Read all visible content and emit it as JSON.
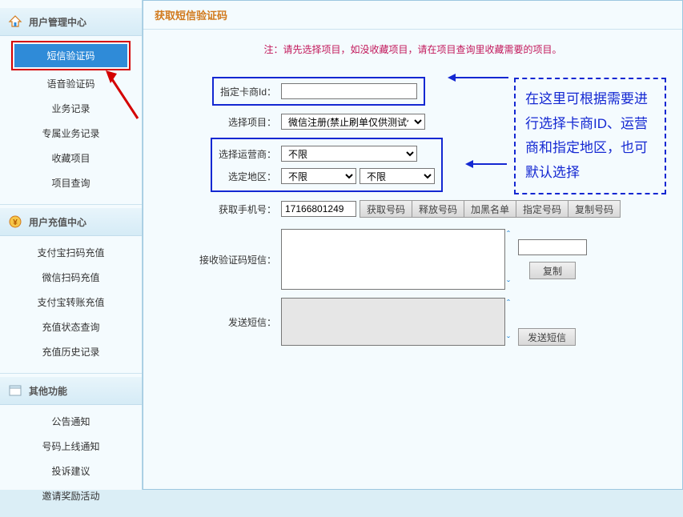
{
  "sidebar": {
    "section1": {
      "title": "用户管理中心",
      "items": [
        "短信验证码",
        "语音验证码",
        "业务记录",
        "专属业务记录",
        "收藏项目",
        "项目查询"
      ],
      "activeIndex": 0
    },
    "section2": {
      "title": "用户充值中心",
      "items": [
        "支付宝扫码充值",
        "微信扫码充值",
        "支付宝转账充值",
        "充值状态查询",
        "充值历史记录"
      ]
    },
    "section3": {
      "title": "其他功能",
      "items": [
        "公告通知",
        "号码上线通知",
        "投诉建议",
        "邀请奖励活动"
      ]
    }
  },
  "main": {
    "title": "获取短信验证码",
    "note": "注：请先选择项目，如没收藏项目，请在项目查询里收藏需要的项目。",
    "labels": {
      "cardId": "指定卡商Id：",
      "project": "选择项目：",
      "carrier": "选择运营商：",
      "region": "选定地区：",
      "getPhone": "获取手机号：",
      "recvSms": "接收验证码短信：",
      "sendSms": "发送短信："
    },
    "values": {
      "cardId": "",
      "project": "微信注册(禁止刷单仅供测试使",
      "carrier": "不限",
      "region1": "不限",
      "region2": "不限",
      "phone": "17166801249",
      "recvSms": "",
      "copyText": "",
      "sendSms": ""
    },
    "buttons": {
      "getNumber": "获取号码",
      "releaseNumber": "释放号码",
      "blacklist": "加黑名单",
      "specifyNumber": "指定号码",
      "copyNumber": "复制号码",
      "copy": "复制",
      "sendSms": "发送短信"
    },
    "annotation": "在这里可根据需要进行选择卡商ID、运营商和指定地区，也可默认选择"
  }
}
